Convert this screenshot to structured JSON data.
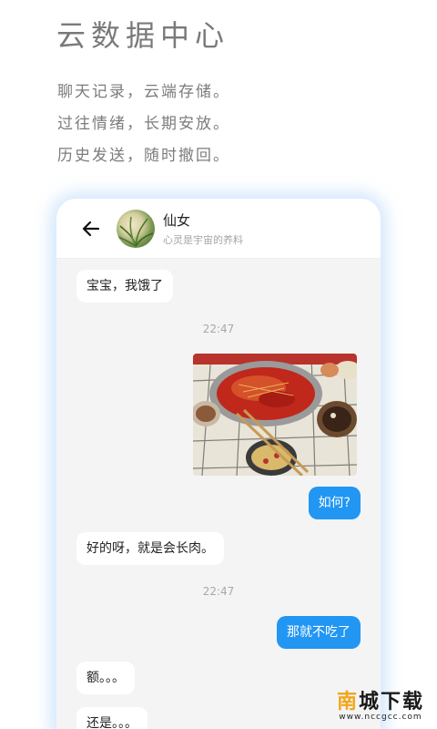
{
  "hero": {
    "title": "云数据中心",
    "lines": [
      "聊天记录，云端存储。",
      "过往情绪，长期安放。",
      "历史发送，随时撤回。"
    ]
  },
  "chat": {
    "contact_name": "仙女",
    "contact_status": "心灵是宇宙的养料",
    "messages": [
      {
        "side": "in",
        "text": "宝宝，我饿了"
      },
      {
        "time": "22:47"
      },
      {
        "side": "out",
        "type": "image",
        "description": "food-photo"
      },
      {
        "side": "out",
        "text": "如何?"
      },
      {
        "side": "in",
        "text": "好的呀，就是会长肉。"
      },
      {
        "time": "22:47"
      },
      {
        "side": "out",
        "text": "那就不吃了"
      },
      {
        "side": "in",
        "text": "额。。。"
      },
      {
        "side": "in",
        "text": "还是。。。"
      }
    ]
  },
  "watermark": {
    "first_char": "南",
    "rest": "城下载",
    "url": "www.nccgcc.com"
  },
  "colors": {
    "out_bubble": "#2196f3",
    "card_glow": "#78b4f5",
    "watermark_accent": "#f2a619"
  },
  "icons": {
    "back": "back-arrow-icon",
    "avatar": "avatar"
  }
}
